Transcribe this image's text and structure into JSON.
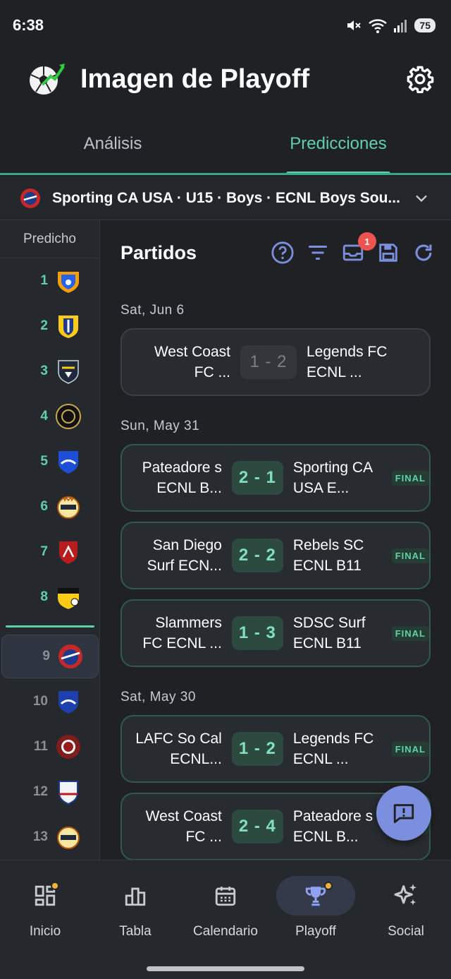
{
  "status": {
    "time": "6:38",
    "battery": "75"
  },
  "app": {
    "title": "Imagen de Playoff"
  },
  "tabs": [
    {
      "label": "Análisis"
    },
    {
      "label": "Predicciones"
    }
  ],
  "selector": {
    "text": "Sporting CA USA · U15 · Boys · ECNL Boys Sou..."
  },
  "rail": {
    "header": "Predicho",
    "ranks": [
      "1",
      "2",
      "3",
      "4",
      "5",
      "6",
      "7",
      "8",
      "9",
      "10",
      "11",
      "12",
      "13"
    ]
  },
  "main": {
    "title": "Partidos",
    "notif_count": "1",
    "final_label": "FINAL",
    "dates": [
      "Sat, Jun 6",
      "Sun, May 31",
      "Sat, May 30"
    ],
    "matches": [
      {
        "home": "West Coast FC ...",
        "score": "1 - 2",
        "away": "Legends FC ECNL ..."
      },
      {
        "home": "Pateadore s ECNL B...",
        "score": "2 - 1",
        "away": "Sporting CA USA E..."
      },
      {
        "home": "San Diego Surf ECN...",
        "score": "2 - 2",
        "away": "Rebels SC ECNL B11"
      },
      {
        "home": "Slammers FC ECNL ...",
        "score": "1 - 3",
        "away": "SDSC Surf ECNL B11"
      },
      {
        "home": "LAFC So Cal ECNL...",
        "score": "1 - 2",
        "away": "Legends FC ECNL ..."
      },
      {
        "home": "West Coast FC ...",
        "score": "2 - 4",
        "away": "Pateadore s ECNL B..."
      }
    ]
  },
  "nav": [
    {
      "label": "Inicio"
    },
    {
      "label": "Tabla"
    },
    {
      "label": "Calendario"
    },
    {
      "label": "Playoff"
    },
    {
      "label": "Social"
    }
  ],
  "colors": {
    "accent": "#5fd1a7",
    "blue_icon": "#7b8fde",
    "notif": "#ef5350",
    "dot": "#f3b13c"
  }
}
